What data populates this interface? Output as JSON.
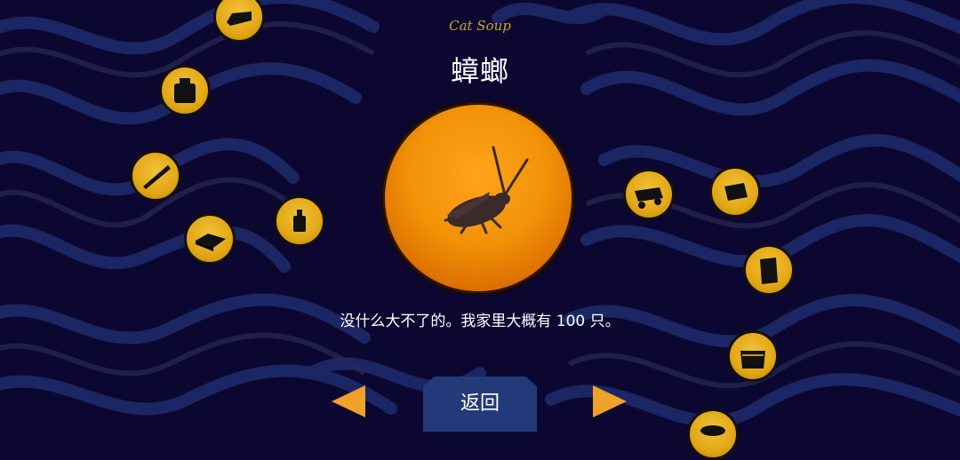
{
  "header": {
    "game_title": "Cat Soup",
    "item_name": "蟑螂"
  },
  "featured_item": {
    "icon": "cockroach-icon",
    "description": "没什么大不了的。我家里大概有 100 只。"
  },
  "navigation": {
    "prev_icon": "triangle-left-icon",
    "next_icon": "triangle-right-icon",
    "back_label": "返回"
  },
  "items": [
    {
      "icon": "box-icon"
    },
    {
      "icon": "jar-icon"
    },
    {
      "icon": "stick-icon"
    },
    {
      "icon": "bed-icon"
    },
    {
      "icon": "bottle-icon"
    },
    {
      "icon": "cart-icon"
    },
    {
      "icon": "crate-icon"
    },
    {
      "icon": "door-icon"
    },
    {
      "icon": "basket-icon"
    },
    {
      "icon": "hat-icon"
    }
  ],
  "colors": {
    "background": "#0c0730",
    "wave_line": "#1d2a6a",
    "accent_orange": "#f39207",
    "token_gold": "#e2a715",
    "back_button": "#233a7a",
    "title_gold": "#c8a63a"
  }
}
